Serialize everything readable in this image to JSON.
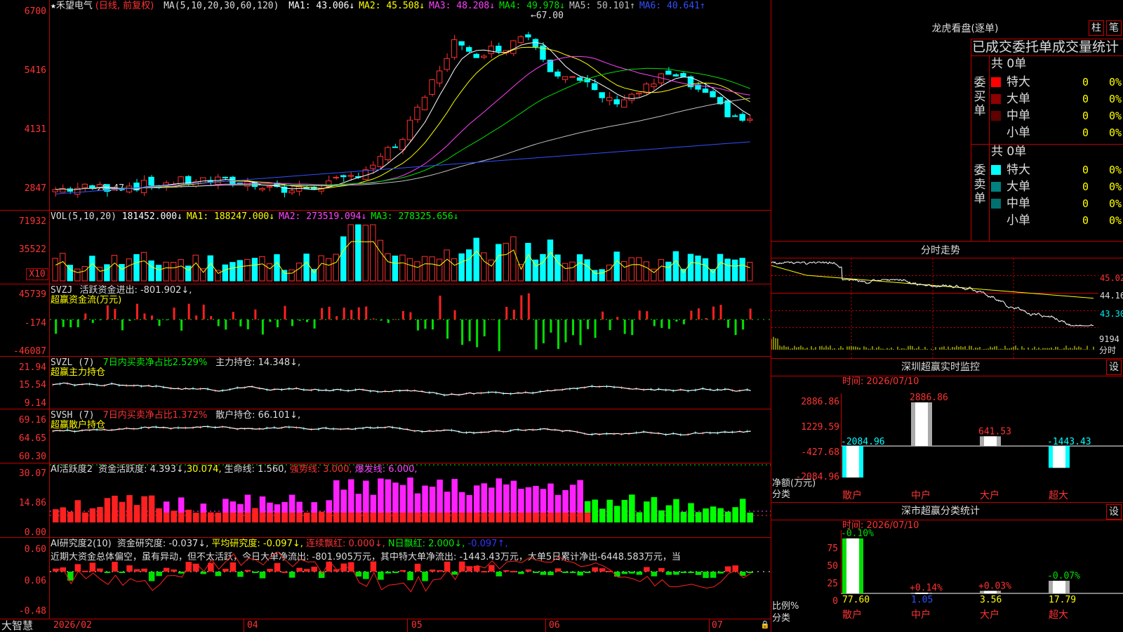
{
  "stock": {
    "name": "禾望电气",
    "mode": "(日线, 前复权)",
    "ma_label": "MA(5,10,20,30,60,120)",
    "ma": [
      {
        "text": "MA1: 43.006↓",
        "color": "#ffffff"
      },
      {
        "text": "MA2: 45.508↓",
        "color": "#ffff00"
      },
      {
        "text": "MA3: 48.208↓",
        "color": "#ff40ff"
      },
      {
        "text": "MA4: 49.978↓",
        "color": "#00e000"
      },
      {
        "text": "MA5: 50.101↑",
        "color": "#c0c0c0"
      },
      {
        "text": "MA6: 40.641↑",
        "color": "#3050ff"
      }
    ],
    "high_mark": "67.00",
    "low_mark": "28.47",
    "price_axis": [
      "6700",
      "5416",
      "4131",
      "2847"
    ]
  },
  "vol": {
    "label": "VOL(5,10,20)",
    "value": "181452.000↓",
    "ma1": "MA1: 188247.000↓",
    "ma2": "MA2: 273519.094↓",
    "ma3": "MA3: 278325.656↓",
    "axis": [
      "71932",
      "35522"
    ],
    "unit": "X10"
  },
  "svzj": {
    "label": "SVZJ",
    "title": "活跃资金进出: -801.902↓,",
    "subtitle": "超赢资金流(万元)",
    "axis": [
      "45739",
      "-174",
      "-46087"
    ]
  },
  "svzl": {
    "label": "SVZL (7)",
    "ratio": "7日内买卖净占比2.529%",
    "hold": "主力持仓: 14.348↓,",
    "subtitle": "超赢主力持仓",
    "axis": [
      "21.94",
      "15.54",
      "9.14"
    ]
  },
  "svsh": {
    "label": "SVSH (7)",
    "ratio": "7日内买卖净占比1.372%",
    "hold": "散户持仓: 66.101↓,",
    "subtitle": "超赢散户持仓",
    "axis": [
      "69.16",
      "64.65",
      "60.30"
    ]
  },
  "ai2": {
    "label": "AI活跃度2",
    "a": "资金活跃度: 4.393↓,",
    "b": "30.074,",
    "c": "生命线: 1.560,",
    "d": "强势线: 3.000,",
    "e": "爆发线: 6.000,",
    "axis": [
      "30.07",
      "14.86",
      "0.00"
    ]
  },
  "ai3": {
    "label": "AI研究度2(10)",
    "a": "资金研究度: -0.037↓,",
    "b": "平均研究度: -0.097↓,",
    "c": "连续飘红: 0.000↓,",
    "d": "N日飘红: 2.000↓,",
    "e": "-0.097↑,",
    "comment": "近期大资金总体偏空，虽有异动，但不太活跃，今日大单净流出: -801.905万元，其中特大单净流出: -1443.43万元，大单5日累计净出-6448.583万元，当",
    "axis": [
      "0.60",
      "0.06",
      "-0.48"
    ]
  },
  "timeaxis": {
    "app": "大智慧",
    "labels": [
      "2026/02",
      "04",
      "05",
      "06",
      "07"
    ]
  },
  "longhu": {
    "title": "龙虎看盘(逐单)",
    "btn1": "柱",
    "btn2": "笔",
    "subtitle": "已成交委托单成交量统计",
    "buy_label": "委买单",
    "sell_label": "委卖单",
    "buy_total": "共 0单",
    "sell_total": "共 0单",
    "buy_rows": [
      {
        "name": "特大",
        "count": "0",
        "pct": "0%",
        "color": "#ff0000"
      },
      {
        "name": "大单",
        "count": "0",
        "pct": "0%",
        "color": "#900000"
      },
      {
        "name": "中单",
        "count": "0",
        "pct": "0%",
        "color": "#600000"
      },
      {
        "name": "小单",
        "count": "0",
        "pct": "0%",
        "color": "#000000"
      }
    ],
    "sell_rows": [
      {
        "name": "特大",
        "count": "0",
        "pct": "0%",
        "color": "#00ffff"
      },
      {
        "name": "大单",
        "count": "0",
        "pct": "0%",
        "color": "#008080"
      },
      {
        "name": "中单",
        "count": "0",
        "pct": "0%",
        "color": "#007070"
      },
      {
        "name": "小单",
        "count": "0",
        "pct": "0%",
        "color": "#000000"
      }
    ]
  },
  "minute": {
    "title": "分时走势",
    "axis": [
      "45.02",
      "44.16",
      "43.30",
      "9194",
      "分时"
    ]
  },
  "monitor": {
    "title": "深圳超赢实时监控",
    "btn": "设",
    "time": "时间: 2026/07/10",
    "axis": [
      "2886.86",
      "1229.59",
      "-427.68",
      "-2084.96"
    ],
    "ylabel": "净额(万元)",
    "xlabel": "分类",
    "bars": [
      {
        "cat": "散户",
        "label": "-2084.96",
        "value": -2084.96,
        "label_color": "#00ffff"
      },
      {
        "cat": "中户",
        "label": "2886.86",
        "value": 2886.86,
        "label_color": "#ff3030"
      },
      {
        "cat": "大户",
        "label": "641.53",
        "value": 641.53,
        "label_color": "#ff3030"
      },
      {
        "cat": "超大",
        "label": "-1443.43",
        "value": -1443.43,
        "label_color": "#00ffff"
      }
    ]
  },
  "classify": {
    "title": "深市超赢分类统计",
    "btn": "设",
    "time": "时间: 2026/07/10",
    "axis": [
      "75",
      "50",
      "25",
      "0"
    ],
    "ylabel": "比例%",
    "xlabel": "分类",
    "bars": [
      {
        "cat": "散户",
        "top": "-0.10%",
        "value": 77.6,
        "bottom": "77.60",
        "top_color": "#00e000"
      },
      {
        "cat": "中户",
        "top": "+0.14%",
        "value": 1.05,
        "bottom": "1.05",
        "top_color": "#ff3030"
      },
      {
        "cat": "大户",
        "top": "+0.03%",
        "value": 3.56,
        "bottom": "3.56",
        "top_color": "#ff3030"
      },
      {
        "cat": "超大",
        "top": "-0.07%",
        "value": 17.79,
        "bottom": "17.79",
        "top_color": "#00e000"
      }
    ]
  }
}
